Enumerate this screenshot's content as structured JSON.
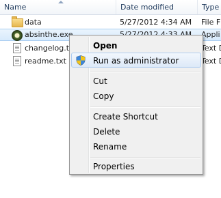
{
  "columns": {
    "name": "Name",
    "date_modified": "Date modified",
    "type": "Type"
  },
  "files": [
    {
      "name": "data",
      "date": "5/27/2012 4:34 AM",
      "type": "File F",
      "icon": "folder-icon"
    },
    {
      "name": "absinthe.exe",
      "date": "5/27/2012 4:33 AM",
      "type": "Appli",
      "icon": "exe-icon",
      "selected": true
    },
    {
      "name": "changelog.txt",
      "date": "",
      "type": "Text D",
      "icon": "doc-icon"
    },
    {
      "name": "readme.txt",
      "date": "",
      "type": "Text D",
      "icon": "doc-icon"
    }
  ],
  "context_menu": {
    "open": "Open",
    "run_as_admin": "Run as administrator",
    "cut": "Cut",
    "copy": "Copy",
    "create_shortcut": "Create Shortcut",
    "delete": "Delete",
    "rename": "Rename",
    "properties": "Properties"
  },
  "colors": {
    "selection": "#cce8ff",
    "menu_background": "#f0f0f0",
    "hover_border": "#aeccf0"
  }
}
